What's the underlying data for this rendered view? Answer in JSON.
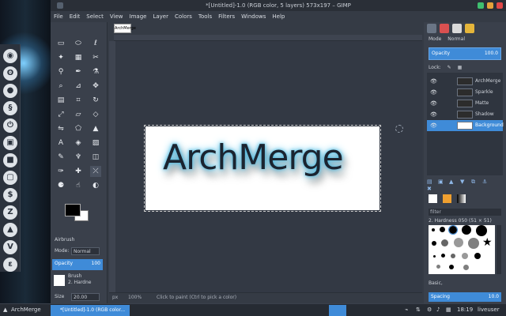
{
  "desktop": {
    "dock_icons": [
      "ubuntu-icon",
      "swirl-icon",
      "apple-icon",
      "debian-icon",
      "power-icon",
      "box-icon",
      "store-icon",
      "window-icon",
      "dollar-icon",
      "zorin-icon",
      "arch-icon",
      "v-icon",
      "swirl2-icon"
    ]
  },
  "window": {
    "title": "*[Untitled]-1.0 (RGB color, 5 layers) 573x197 – GIMP"
  },
  "menu": [
    "File",
    "Edit",
    "Select",
    "View",
    "Image",
    "Layer",
    "Colors",
    "Tools",
    "Filters",
    "Windows",
    "Help"
  ],
  "tool_options": {
    "tool_name": "Airbrush",
    "mode_label": "Mode:",
    "mode_value": "Normal",
    "opacity_label": "Opacity",
    "opacity_value": "100",
    "brush_label": "Brush",
    "brush_value": "2. Hardne",
    "size_label": "Size",
    "size_value": "20.00"
  },
  "image_tab": {
    "thumb_text": "ArchMerge"
  },
  "canvas": {
    "image_text": "ArchMerge"
  },
  "statusbar": {
    "unit": "px",
    "zoom": "100%",
    "hint": "Click to paint (Ctrl to pick a color)"
  },
  "layers_panel": {
    "mode_label": "Mode",
    "mode_value": "Normal",
    "opacity_label": "Opacity",
    "opacity_value": "100.0",
    "lock_label": "Lock:",
    "layers": [
      {
        "name": "ArchMerge",
        "selected": false
      },
      {
        "name": "Sparkle",
        "selected": false
      },
      {
        "name": "Matte",
        "selected": false
      },
      {
        "name": "Shadow",
        "selected": false
      },
      {
        "name": "Background",
        "selected": true
      }
    ]
  },
  "brushes_panel": {
    "filter_placeholder": "filter",
    "selected_brush": "2. Hardness 050 (51 × 51)",
    "tag": "Basic,",
    "spacing_label": "Spacing",
    "spacing_value": "10.0"
  },
  "taskbar": {
    "start_label": "ArchMerge",
    "task_label": "*[Untitled]-1.0 (RGB color...",
    "clock": "18:19",
    "user": "liveuser"
  },
  "colors": {
    "accent": "#3f8bd8",
    "panel": "#3a404b",
    "canvas_bg": "#333944"
  }
}
